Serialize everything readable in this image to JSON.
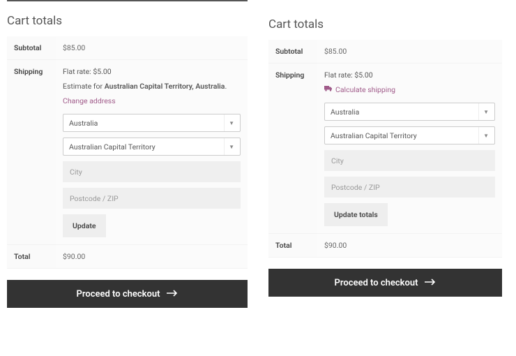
{
  "left": {
    "title": "Cart totals",
    "subtotal_label": "Subtotal",
    "subtotal_value": "$85.00",
    "shipping_label": "Shipping",
    "flat_rate": "Flat rate: $5.00",
    "estimate_prefix": "Estimate for ",
    "estimate_location": "Australian Capital Territory, Australia",
    "estimate_suffix": ".",
    "change_address": "Change address",
    "country": "Australia",
    "state": "Australian Capital Territory",
    "city_placeholder": "City",
    "postcode_placeholder": "Postcode / ZIP",
    "update_button": "Update",
    "total_label": "Total",
    "total_value": "$90.00",
    "checkout_label": "Proceed to checkout"
  },
  "right": {
    "title": "Cart totals",
    "subtotal_label": "Subtotal",
    "subtotal_value": "$85.00",
    "shipping_label": "Shipping",
    "flat_rate": "Flat rate: $5.00",
    "calculate_shipping": "Calculate shipping",
    "country": "Australia",
    "state": "Australian Capital Territory",
    "city_placeholder": "City",
    "postcode_placeholder": "Postcode / ZIP",
    "update_button": "Update totals",
    "total_label": "Total",
    "total_value": "$90.00",
    "checkout_label": "Proceed to checkout"
  },
  "colors": {
    "link": "#a05b8a",
    "checkout_bg": "#333333"
  }
}
